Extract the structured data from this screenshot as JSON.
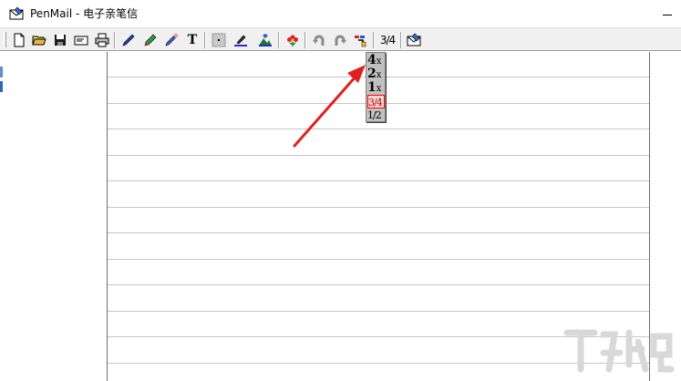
{
  "window": {
    "title": "PenMail - 电子亲笔信",
    "app_icon": "penmail-envelope-icon",
    "minimize_icon": "minimize-icon"
  },
  "toolbar": {
    "buttons": [
      {
        "id": "new",
        "icon": "new-document-icon"
      },
      {
        "id": "open",
        "icon": "open-folder-icon"
      },
      {
        "id": "save",
        "icon": "save-disk-icon"
      },
      {
        "id": "mail",
        "icon": "envelope-icon"
      },
      {
        "id": "print",
        "icon": "printer-icon"
      },
      {
        "id": "pen",
        "icon": "pen-icon"
      },
      {
        "id": "marker",
        "icon": "marker-icon"
      },
      {
        "id": "eraser",
        "icon": "eraser-pen-icon"
      },
      {
        "id": "text",
        "icon": "text-tool-icon",
        "label": "T"
      },
      {
        "id": "dot",
        "icon": "dot-size-icon"
      },
      {
        "id": "color",
        "icon": "pen-color-icon"
      },
      {
        "id": "background",
        "icon": "background-picture-icon"
      },
      {
        "id": "stamp",
        "icon": "flower-stamp-icon"
      },
      {
        "id": "undo",
        "icon": "undo-icon"
      },
      {
        "id": "redo",
        "icon": "redo-icon"
      },
      {
        "id": "zoom",
        "icon": "zoom-tool-icon"
      },
      {
        "id": "zoom-level",
        "label": "3/4"
      },
      {
        "id": "send",
        "icon": "send-envelope-icon"
      }
    ]
  },
  "zoom_menu": {
    "items": [
      {
        "value": "4",
        "suffix": "x"
      },
      {
        "value": "2",
        "suffix": "x"
      },
      {
        "value": "1",
        "suffix": "x"
      },
      {
        "value": "3/4",
        "suffix": "",
        "selected": true
      },
      {
        "value": "1/2",
        "suffix": ""
      }
    ]
  },
  "annotation": {
    "color": "#e02020"
  },
  "colors": {
    "toolbar_bg": "#f0f0f0",
    "paper_rule": "#c6c6c6",
    "menu_bg": "#c0c0c0",
    "highlight": "#ff0000"
  }
}
